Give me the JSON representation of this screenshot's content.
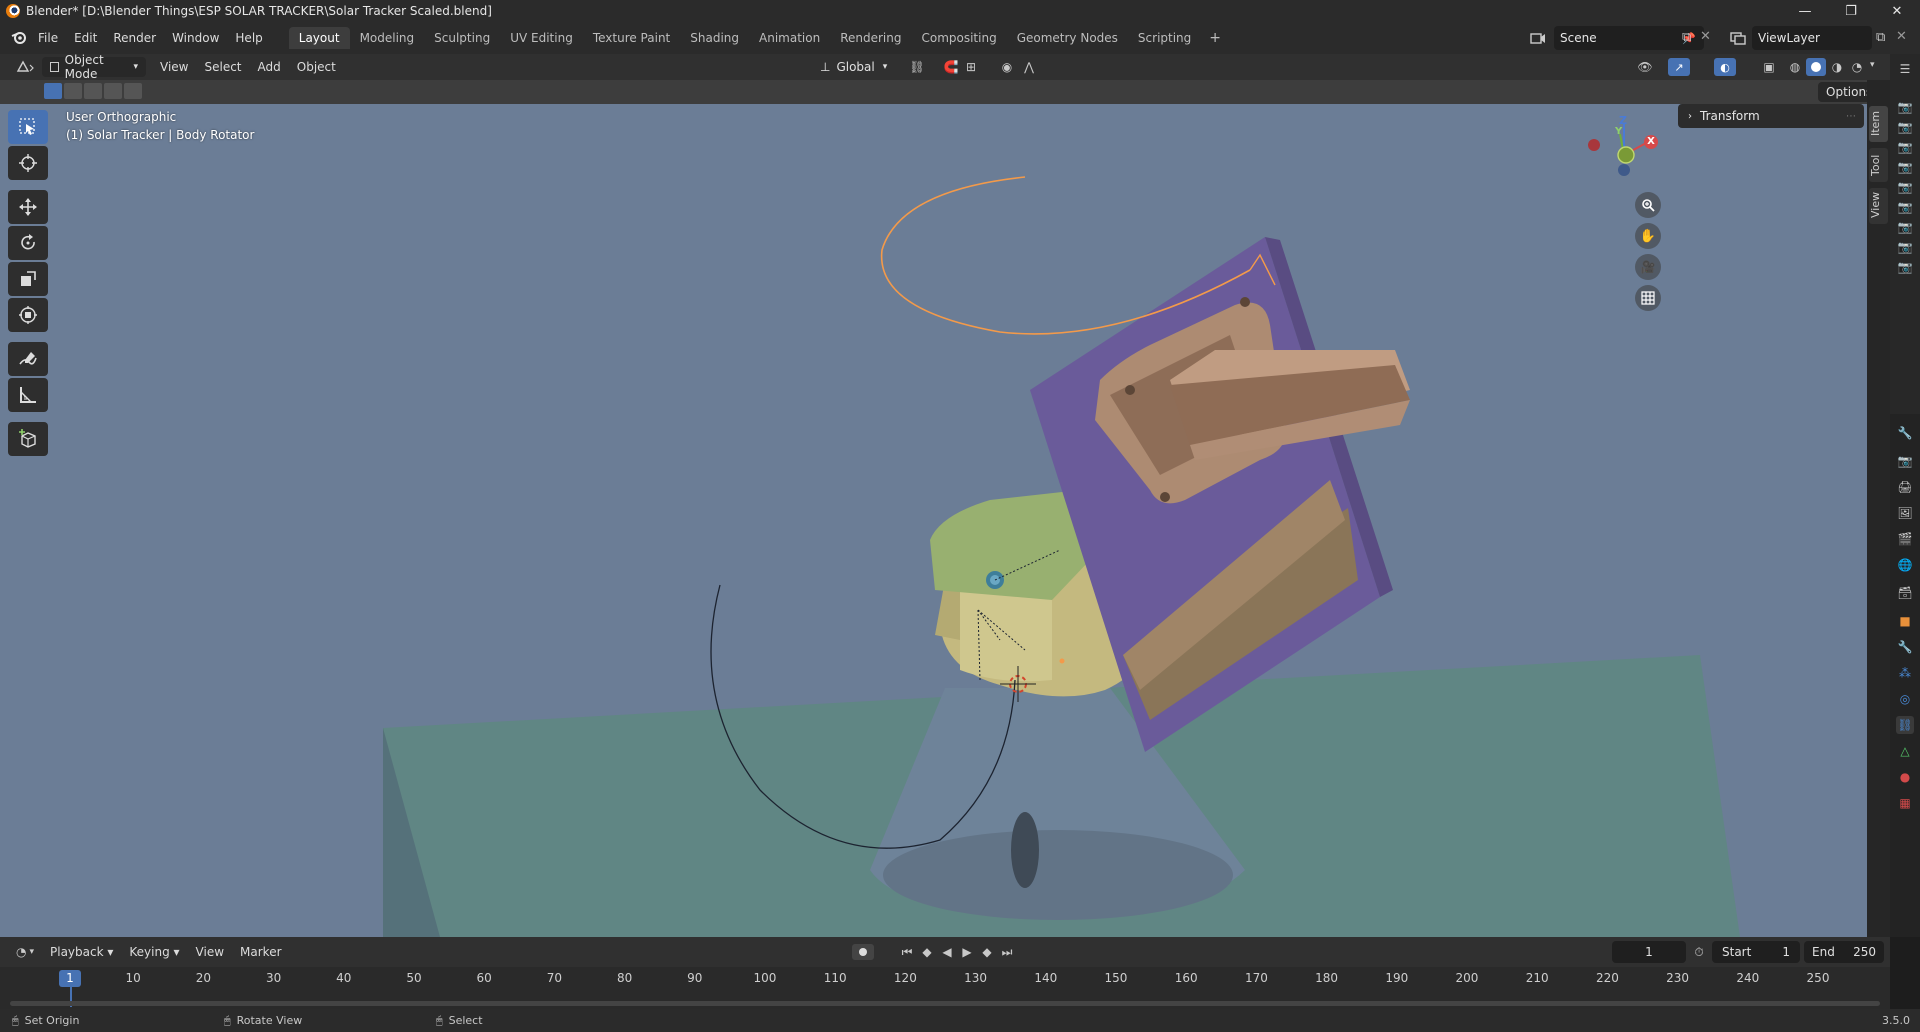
{
  "titlebar": {
    "title": "Blender* [D:\\Blender Things\\ESP SOLAR TRACKER\\Solar Tracker Scaled.blend]",
    "minimize": "—",
    "maximize": "❐",
    "close": "✕"
  },
  "menubar": {
    "menus": [
      "File",
      "Edit",
      "Render",
      "Window",
      "Help"
    ],
    "workspaces": [
      "Layout",
      "Modeling",
      "Sculpting",
      "UV Editing",
      "Texture Paint",
      "Shading",
      "Animation",
      "Rendering",
      "Compositing",
      "Geometry Nodes",
      "Scripting"
    ],
    "active_workspace": "Layout",
    "add_tab": "+",
    "scene": "Scene",
    "view_layer": "ViewLayer"
  },
  "viewport_header": {
    "mode": "Object Mode",
    "menus": [
      "View",
      "Select",
      "Add",
      "Object"
    ],
    "orientation": "Global",
    "options": "Options"
  },
  "viewport": {
    "view_name": "User Orthographic",
    "object_info": "(1) Solar Tracker | Body Rotator",
    "transform_panel": "Transform",
    "sidebar_tabs": [
      "Item",
      "Tool",
      "View"
    ],
    "gizmo_axes": {
      "x": "X",
      "y": "Y",
      "z": "Z"
    }
  },
  "timeline": {
    "menus": [
      "Playback",
      "Keying",
      "View",
      "Marker"
    ],
    "current_frame": "1",
    "start_label": "Start",
    "start": "1",
    "end_label": "End",
    "end": "250",
    "ruler": [
      "1",
      "10",
      "20",
      "30",
      "40",
      "50",
      "60",
      "70",
      "80",
      "90",
      "100",
      "110",
      "120",
      "130",
      "140",
      "150",
      "160",
      "170",
      "180",
      "190",
      "200",
      "210",
      "220",
      "230",
      "240",
      "250"
    ]
  },
  "statusbar": {
    "left": "Set Origin",
    "middle": "Rotate View",
    "right": "Select",
    "version": "3.5.0"
  },
  "colors": {
    "viewport_bg": "#6b7d96",
    "accent": "#4772b3",
    "selection_orange": "#f39a4a"
  }
}
